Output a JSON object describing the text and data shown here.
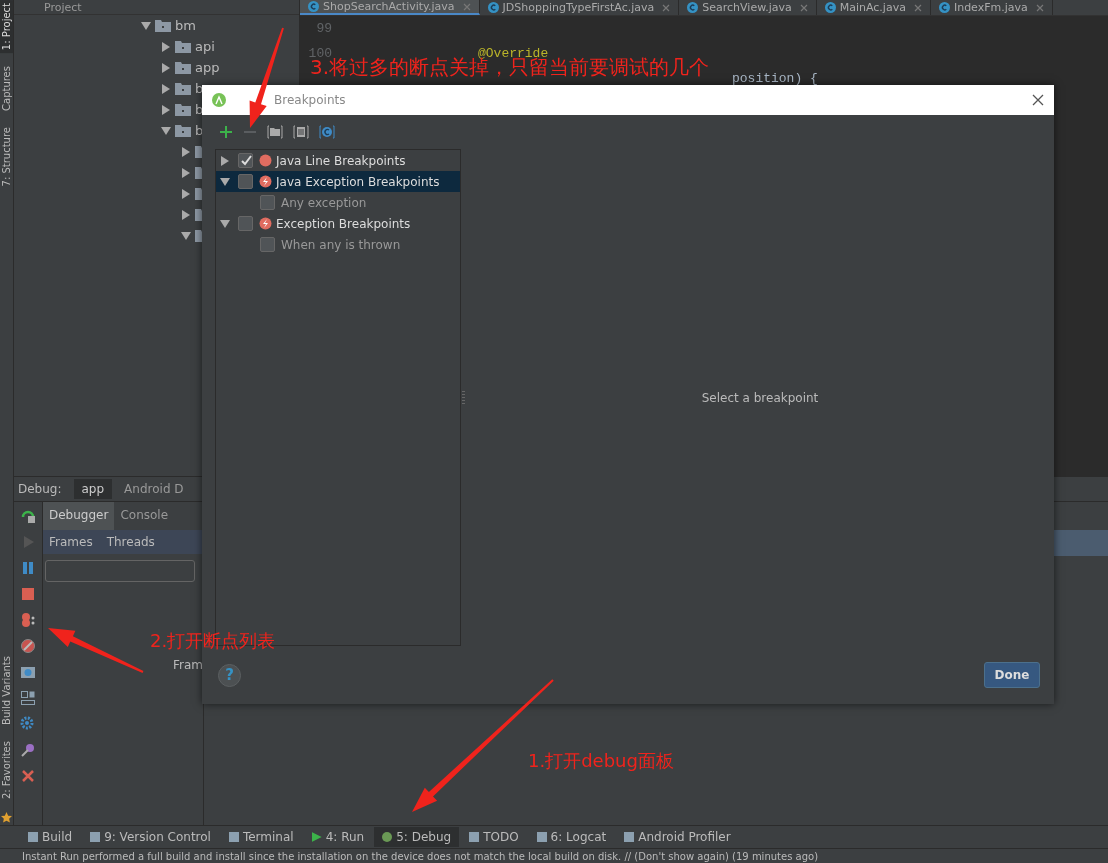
{
  "left_strip": {
    "top_tabs": [
      {
        "label": "1: Project",
        "selected": true
      },
      {
        "label": "Captures",
        "selected": false
      },
      {
        "label": "7: Structure",
        "selected": false
      }
    ],
    "bottom_tabs": [
      {
        "label": "Build Variants",
        "selected": false
      },
      {
        "label": "2: Favorites",
        "selected": false
      }
    ]
  },
  "project_panel": {
    "title": "Project",
    "tree": [
      {
        "label": "bm",
        "expanded": true,
        "children": [
          {
            "label": "api",
            "expanded": false
          },
          {
            "label": "app",
            "expanded": false
          },
          {
            "label": "b",
            "expanded": false
          },
          {
            "label": "b",
            "expanded": false
          },
          {
            "label": "b",
            "expanded": true,
            "children": [
              {
                "expanded": false
              },
              {
                "expanded": false
              },
              {
                "expanded": false
              },
              {
                "expanded": false
              },
              {
                "expanded": true
              }
            ]
          }
        ]
      }
    ]
  },
  "editor": {
    "tabs": [
      {
        "label": "ShopSearchActivity.java",
        "selected": true
      },
      {
        "label": "JDShoppingTypeFirstAc.java",
        "selected": false
      },
      {
        "label": "SearchView.java",
        "selected": false
      },
      {
        "label": "MainAc.java",
        "selected": false
      },
      {
        "label": "IndexFm.java",
        "selected": false
      }
    ],
    "lines": [
      {
        "number": "99"
      },
      {
        "number": "100",
        "text": "@Override",
        "kind": "annotation"
      },
      {
        "text": "position) {",
        "kind": "obscured"
      }
    ]
  },
  "debug_panel": {
    "title": "Debug:",
    "sessions": [
      {
        "label": "app",
        "selected": true
      },
      {
        "label": "Android D",
        "selected": false
      }
    ],
    "tabs": [
      {
        "label": "Debugger",
        "selected": true
      },
      {
        "label": "Console",
        "selected": false
      }
    ],
    "subtabs": [
      {
        "label": "Frames"
      },
      {
        "label": "Threads"
      }
    ],
    "frames_text": "Fram"
  },
  "tool_windows": [
    {
      "label": "Build",
      "selected": false
    },
    {
      "label": "9: Version Control",
      "selected": false
    },
    {
      "label": "Terminal",
      "selected": false
    },
    {
      "label": "4: Run",
      "selected": false
    },
    {
      "label": "5: Debug",
      "selected": true
    },
    {
      "label": "TODO",
      "selected": false
    },
    {
      "label": "6: Logcat",
      "selected": false
    },
    {
      "label": "Android Profiler",
      "selected": false
    }
  ],
  "status_bar": "Instant Run performed a full build and install since the installation on the device does not match the local build on disk. // (Don't show again) (19 minutes ago)",
  "dialog": {
    "title": "Breakpoints",
    "groups": [
      {
        "label": "Java Line Breakpoints",
        "kind": "line",
        "expanded": false,
        "checked": true,
        "selected": false
      },
      {
        "label": "Java Exception Breakpoints",
        "kind": "exception",
        "expanded": true,
        "checked": false,
        "selected": true,
        "children": [
          {
            "label": "Any exception",
            "checked": false
          }
        ]
      },
      {
        "label": "Exception Breakpoints",
        "kind": "exception",
        "expanded": true,
        "checked": false,
        "selected": false,
        "children": [
          {
            "label": "When any is thrown",
            "checked": false
          }
        ]
      }
    ],
    "detail_placeholder": "Select a breakpoint",
    "help": "?",
    "done_button": "Done"
  },
  "annotations": [
    "3.将过多的断点关掉，只留当前要调试的几个",
    "2.打开断点列表",
    "1.打开debug面板"
  ]
}
